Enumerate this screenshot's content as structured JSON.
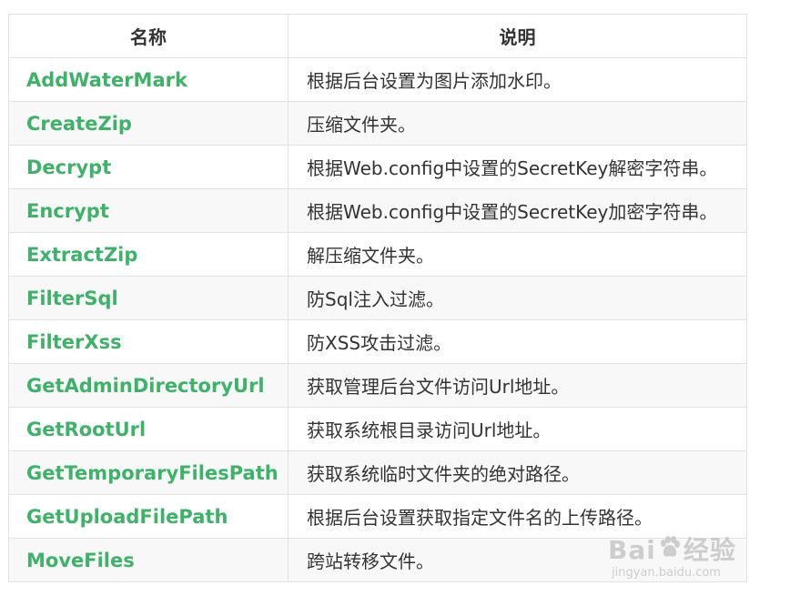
{
  "table": {
    "headers": [
      "名称",
      "说明"
    ],
    "rows": [
      {
        "name": "AddWaterMark",
        "desc": "根据后台设置为图片添加水印。"
      },
      {
        "name": "CreateZip",
        "desc": "压缩文件夹。"
      },
      {
        "name": "Decrypt",
        "desc": "根据Web.config中设置的SecretKey解密字符串。"
      },
      {
        "name": "Encrypt",
        "desc": "根据Web.config中设置的SecretKey加密字符串。"
      },
      {
        "name": "ExtractZip",
        "desc": "解压缩文件夹。"
      },
      {
        "name": "FilterSql",
        "desc": "防Sql注入过滤。"
      },
      {
        "name": "FilterXss",
        "desc": "防XSS攻击过滤。"
      },
      {
        "name": "GetAdminDirectoryUrl",
        "desc": "获取管理后台文件访问Url地址。"
      },
      {
        "name": "GetRootUrl",
        "desc": "获取系统根目录访问Url地址。"
      },
      {
        "name": "GetTemporaryFilesPath",
        "desc": "获取系统临时文件夹的绝对路径。"
      },
      {
        "name": "GetUploadFilePath",
        "desc": "根据后台设置获取指定文件名的上传路径。"
      },
      {
        "name": "MoveFiles",
        "desc": "跨站转移文件。"
      }
    ]
  },
  "watermark": {
    "logo_left": "Bai",
    "logo_right": "经验",
    "url": "jingyan.baidu.com",
    "icon": "baidu-paw-icon"
  },
  "colors": {
    "name_text": "#3db368",
    "body_text": "#333333",
    "border": "#e2e2e2",
    "stripe": "#f8f8f8"
  }
}
